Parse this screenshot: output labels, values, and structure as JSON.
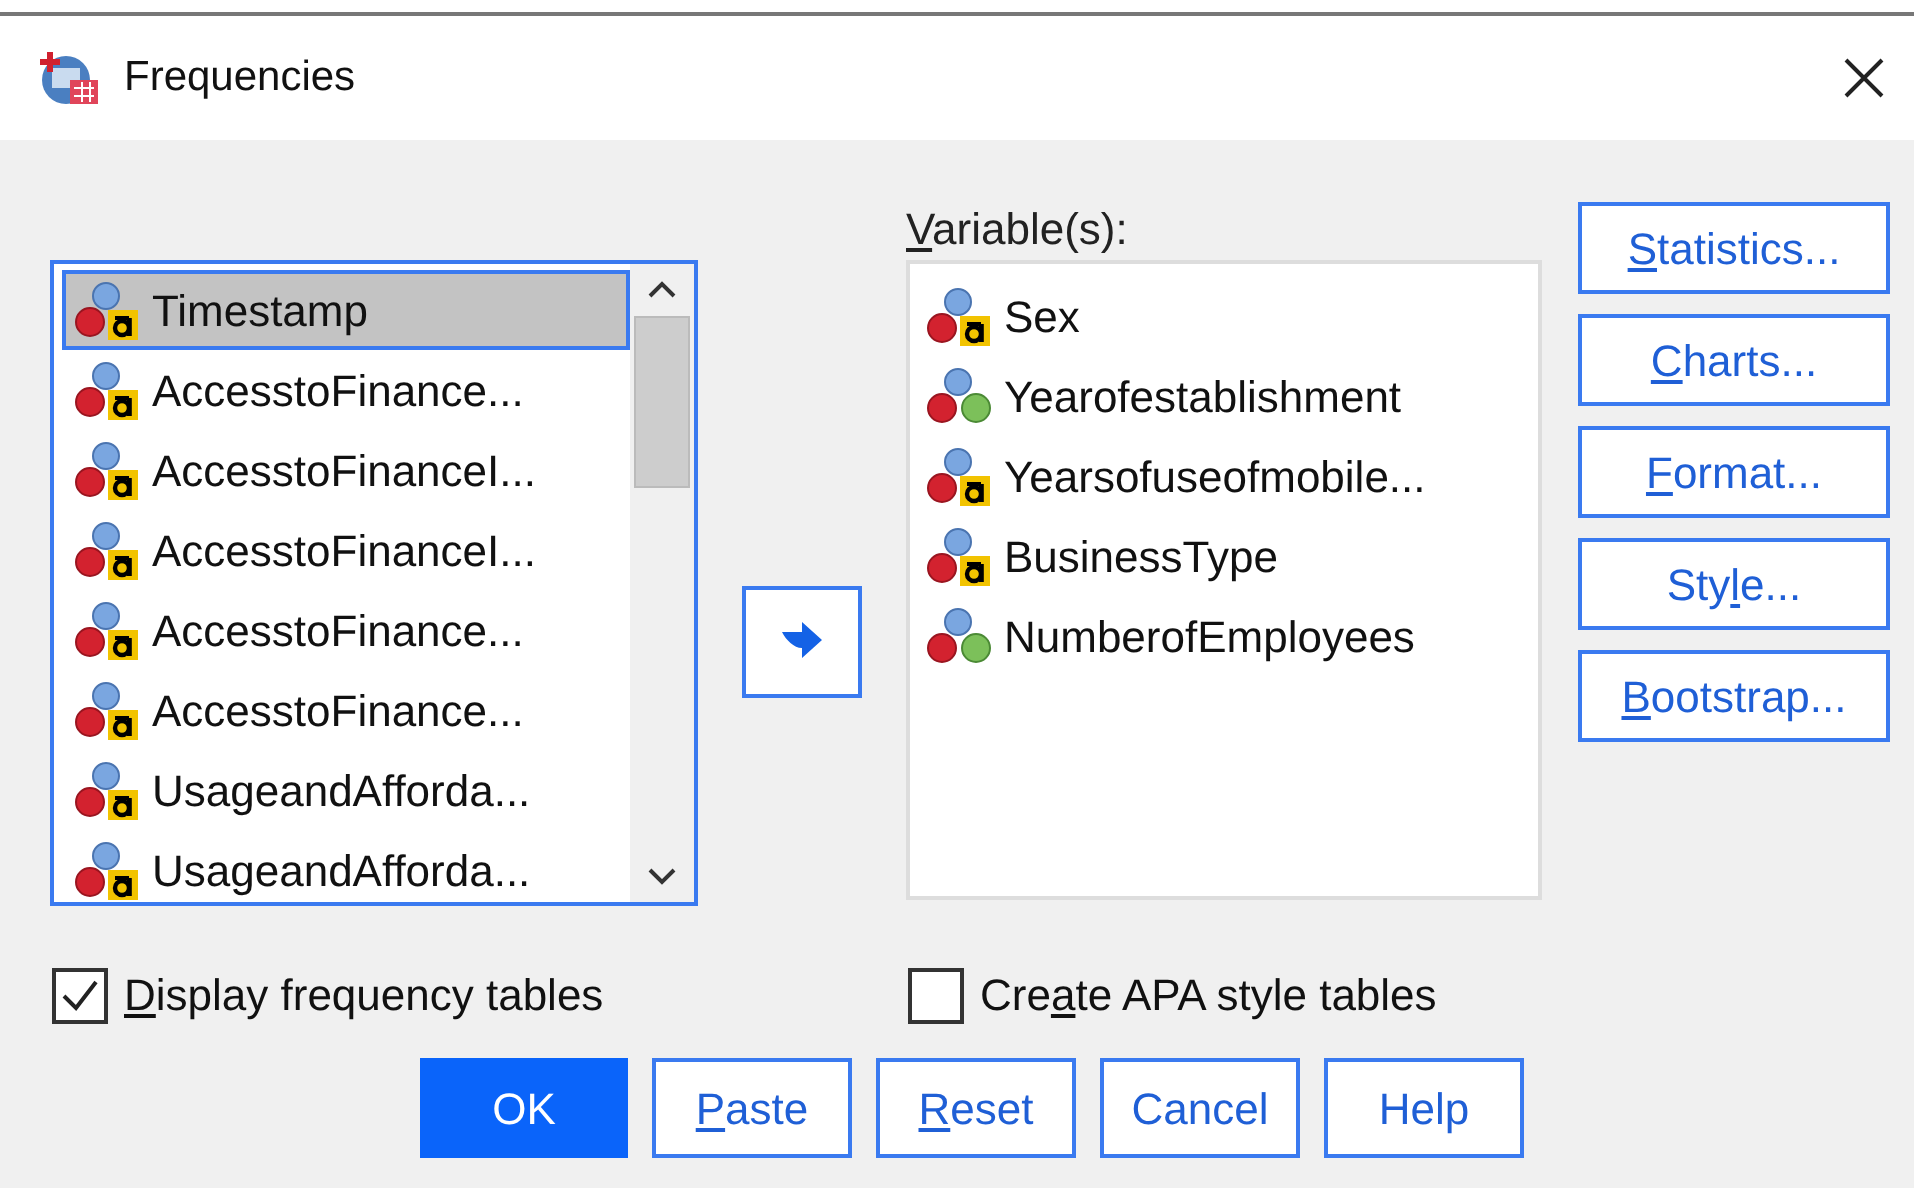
{
  "window": {
    "title": "Frequencies"
  },
  "source_list": {
    "items": [
      {
        "label": "Timestamp",
        "kind": "string",
        "selected": true
      },
      {
        "label": "AccesstoFinance...",
        "kind": "string",
        "selected": false
      },
      {
        "label": "AccesstoFinanceI...",
        "kind": "string",
        "selected": false
      },
      {
        "label": "AccesstoFinanceI...",
        "kind": "string",
        "selected": false
      },
      {
        "label": "AccesstoFinance...",
        "kind": "string",
        "selected": false
      },
      {
        "label": "AccesstoFinance...",
        "kind": "string",
        "selected": false
      },
      {
        "label": "UsageandAfforda...",
        "kind": "string",
        "selected": false
      },
      {
        "label": "UsageandAfforda...",
        "kind": "string",
        "selected": false
      }
    ]
  },
  "variables": {
    "label": {
      "key": "V",
      "after": "ariable(s):"
    },
    "items": [
      {
        "label": "Sex",
        "kind": "string"
      },
      {
        "label": "Yearofestablishment",
        "kind": "numeric"
      },
      {
        "label": "Yearsofuseofmobile...",
        "kind": "string"
      },
      {
        "label": "BusinessType",
        "kind": "string"
      },
      {
        "label": "NumberofEmployees",
        "kind": "numeric"
      }
    ]
  },
  "side_buttons": [
    {
      "key": "S",
      "after": "tatistics..."
    },
    {
      "key": "C",
      "after": "harts..."
    },
    {
      "key": "F",
      "after": "ormat..."
    },
    {
      "before": "Sty",
      "key": "l",
      "after": "e..."
    },
    {
      "key": "B",
      "after": "ootstrap..."
    }
  ],
  "options": [
    {
      "key": "D",
      "after": "isplay frequency tables",
      "checked": true
    },
    {
      "before": "Cre",
      "key": "a",
      "after": "te APA style tables",
      "checked": false
    }
  ],
  "buttons": [
    {
      "before": "OK",
      "default": true
    },
    {
      "key": "P",
      "after": "aste",
      "default": false
    },
    {
      "key": "R",
      "after": "eset",
      "default": false
    },
    {
      "before": "Cancel",
      "default": false
    },
    {
      "before": "Help",
      "default": false
    }
  ]
}
